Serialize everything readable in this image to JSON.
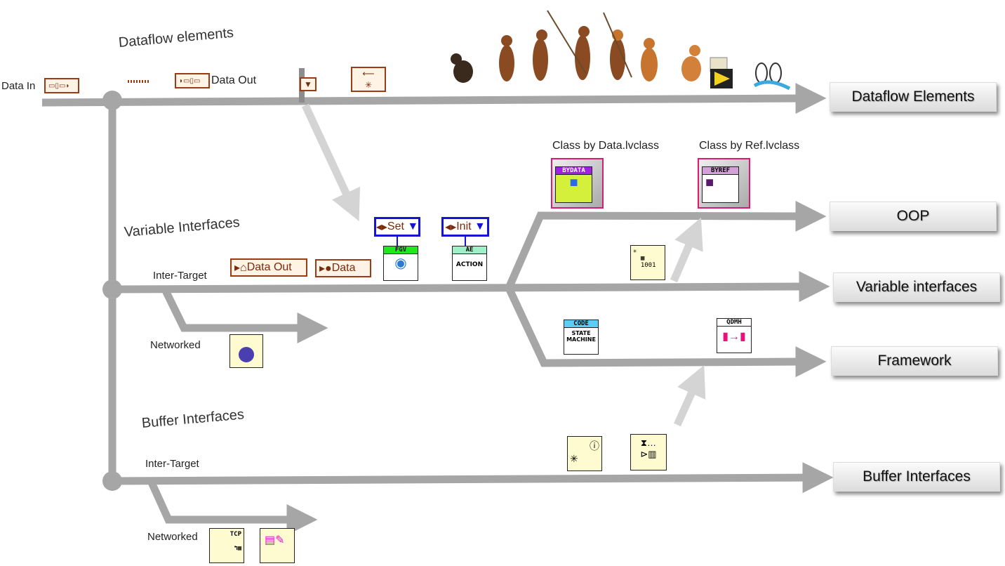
{
  "sections": {
    "dataflow": "Dataflow elements",
    "variable": "Variable Interfaces",
    "buffer": "Buffer Interfaces"
  },
  "labels": {
    "data_in": "Data In",
    "data_out": "Data Out",
    "var_inter_target": "Inter-Target",
    "var_networked": "Networked",
    "buf_inter_target": "Inter-Target",
    "buf_networked": "Networked",
    "local_var": "Data Out",
    "global_var": "Data",
    "fgv_enum": "Set",
    "ae_enum": "Init",
    "class_by_data": "Class by Data.lvclass",
    "class_by_ref": "Class by Ref.lvclass"
  },
  "icons": {
    "fgv": "FGV",
    "ae": "AE",
    "ae_body": "ACTION",
    "by_data": "BYDATA",
    "by_ref": "BYREF",
    "code": "CODE",
    "state_machine": "STATE MACHINE",
    "qdmh": "QDMH",
    "tcp": "TCP"
  },
  "destinations": [
    {
      "label": "Dataflow Elements"
    },
    {
      "label": "OOP"
    },
    {
      "label": "Variable interfaces"
    },
    {
      "label": "Framework"
    },
    {
      "label": "Buffer Interfaces"
    }
  ],
  "colors": {
    "wire": "#a6a6a6",
    "wire_light": "#d4d4d4",
    "terminal": "#9c3c14",
    "enum_border": "#1414d8",
    "class_border": "#d81b73"
  }
}
